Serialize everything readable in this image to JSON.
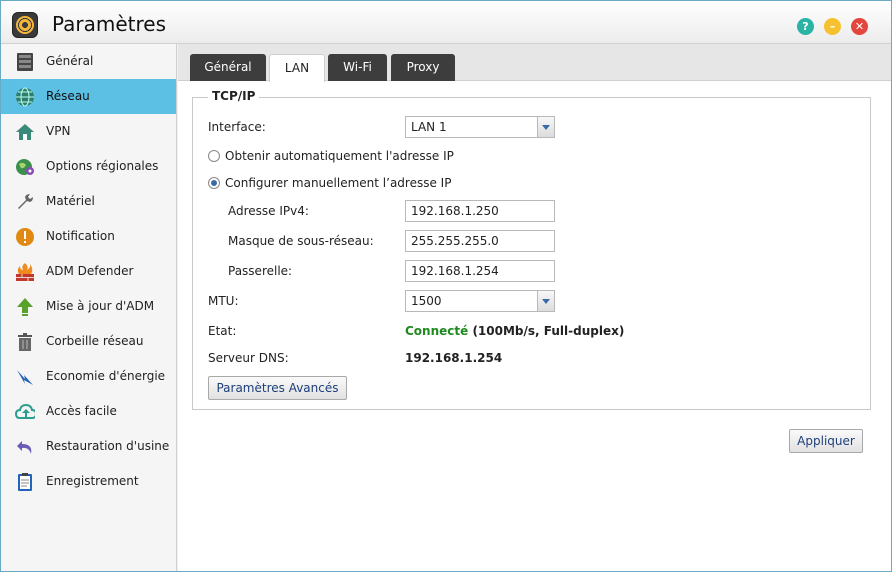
{
  "window": {
    "title": "Paramètres"
  },
  "window_buttons": {
    "help": "?",
    "minimize": "–",
    "close": "✕"
  },
  "sidebar": {
    "items": [
      {
        "label": "Général",
        "icon": "server-icon"
      },
      {
        "label": "Réseau",
        "icon": "globe-network-icon"
      },
      {
        "label": "VPN",
        "icon": "vpn-house-icon"
      },
      {
        "label": "Options régionales",
        "icon": "globe-pin-icon"
      },
      {
        "label": "Matériel",
        "icon": "wrench-icon"
      },
      {
        "label": "Notification",
        "icon": "exclamation-icon"
      },
      {
        "label": "ADM Defender",
        "icon": "firewall-icon"
      },
      {
        "label": "Mise à jour d'ADM",
        "icon": "upload-arrow-icon"
      },
      {
        "label": "Corbeille réseau",
        "icon": "trash-icon"
      },
      {
        "label": "Economie d'énergie",
        "icon": "energy-icon"
      },
      {
        "label": "Accès facile",
        "icon": "cloud-icon"
      },
      {
        "label": "Restauration d'usine",
        "icon": "undo-icon"
      },
      {
        "label": "Enregistrement",
        "icon": "clipboard-icon"
      }
    ],
    "active_index": 1
  },
  "tabs": [
    "Général",
    "LAN",
    "Wi-Fi",
    "Proxy"
  ],
  "active_tab": "LAN",
  "tcpip": {
    "legend": "TCP/IP",
    "interface_label": "Interface:",
    "interface_value": "LAN 1",
    "radio_auto": "Obtenir automatiquement l'adresse IP",
    "radio_manual": "Configurer manuellement l’adresse IP",
    "ipv4_label": "Adresse IPv4:",
    "ipv4_value": "192.168.1.250",
    "mask_label": "Masque de sous-réseau:",
    "mask_value": "255.255.255.0",
    "gateway_label": "Passerelle:",
    "gateway_value": "192.168.1.254",
    "mtu_label": "MTU:",
    "mtu_value": "1500",
    "state_label": "Etat:",
    "state_status": "Connecté",
    "state_detail": " (100Mb/s, Full-duplex)",
    "dns_label": "Serveur DNS:",
    "dns_value": "192.168.1.254",
    "advanced_button": "Paramètres Avancés"
  },
  "apply_button": "Appliquer",
  "colors": {
    "accent": "#5cc0e4",
    "status_ok": "#1f8a1f",
    "tab_dark": "#3d3d3d"
  }
}
